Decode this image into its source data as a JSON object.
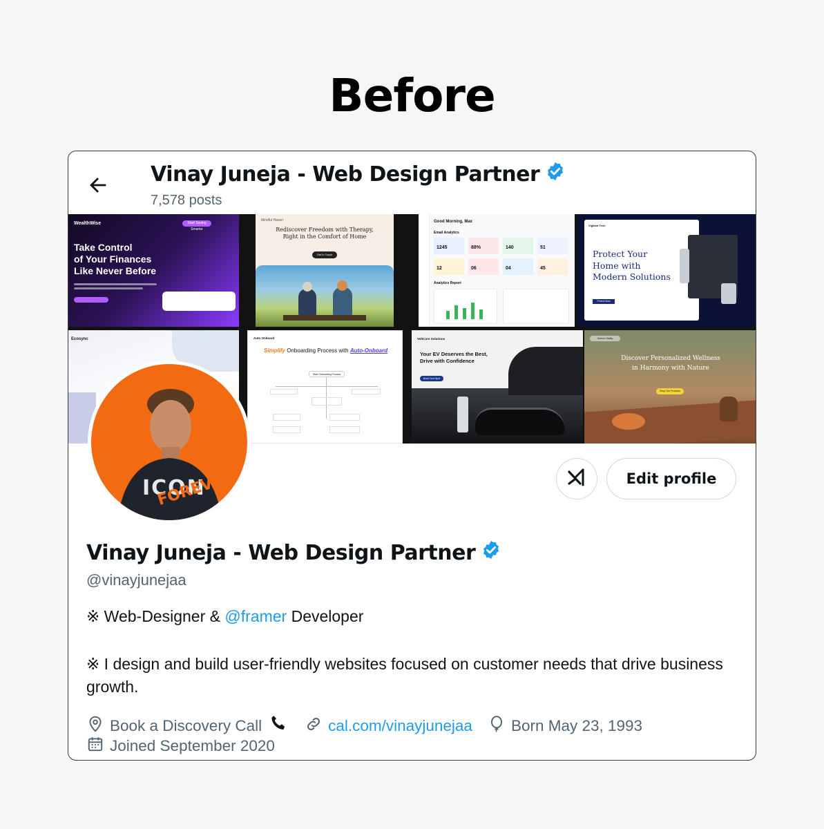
{
  "headline": "Before",
  "header": {
    "display_name": "Vinay Juneja - Web Design Partner",
    "post_count": "7,578 posts"
  },
  "banner": {
    "tiles": [
      {
        "brand": "WealthWise",
        "headline_1": "Take Control",
        "headline_2": "of Your Finances",
        "headline_3": "Like Never Before",
        "cta": "Start Saving Smarter"
      },
      {
        "brand": "Mindful Haven",
        "headline_1": "Rediscover Freedom with Therapy,",
        "headline_2": "Right in the Comfort of Home",
        "cta": "Get In Touch"
      },
      {
        "title": "Good Morning, Max",
        "section_1": "Email Analytics",
        "section_2": "Analytics Report",
        "kpis": [
          "1245",
          "88%",
          "140",
          "51",
          "12",
          "06",
          "04",
          "45"
        ]
      },
      {
        "brand": "Vigilant Tech",
        "headline_1": "Protect Your",
        "headline_2": "Home with",
        "headline_3": "Modern Solutions",
        "cta": "Protect Now"
      },
      {
        "brand": "Ecosync"
      },
      {
        "brand": "Auto Onboard",
        "headline_1": "Simplify",
        "headline_2": "Onboarding Process with",
        "headline_3": "Auto-Onboard",
        "node": "Start Onboarding Process"
      },
      {
        "brand": "VoltCore Solutions",
        "headline_1": "Your EV Deserves the Best,",
        "headline_2": "Drive with Confidence",
        "cta": "Book Your Spot"
      },
      {
        "brand": "Serene Vitality",
        "headline_1": "Discover Personalized Wellness",
        "headline_2": "in Harmony with Nature",
        "cta": "Shop Our Products"
      }
    ]
  },
  "actions": {
    "grok_label": "Grok",
    "edit_profile": "Edit profile"
  },
  "profile": {
    "display_name": "Vinay Juneja - Web Design Partner",
    "handle": "@vinayjunejaa",
    "bio_line1_prefix": "※ Web-Designer & ",
    "bio_line1_mention": "@framer",
    "bio_line1_suffix": " Developer",
    "bio_line2": "※ I design and build user-friendly websites focused on customer needs that drive business growth.",
    "location": "Book a Discovery Call",
    "website": "cal.com/vinayjunejaa",
    "birthday": "Born May 23, 1993",
    "joined": "Joined September 2020",
    "avatar_shirt_text": "ICON",
    "avatar_overlay_text": "FOREVER"
  },
  "colors": {
    "verified": "#1d9bf0",
    "link": "#1d9bf0",
    "avatar_bg": "#f26b12",
    "muted": "#536471"
  },
  "icons": [
    "back-arrow-icon",
    "verified-badge-icon",
    "grok-icon",
    "location-pin-icon",
    "phone-icon",
    "link-icon",
    "balloon-icon",
    "calendar-icon"
  ]
}
